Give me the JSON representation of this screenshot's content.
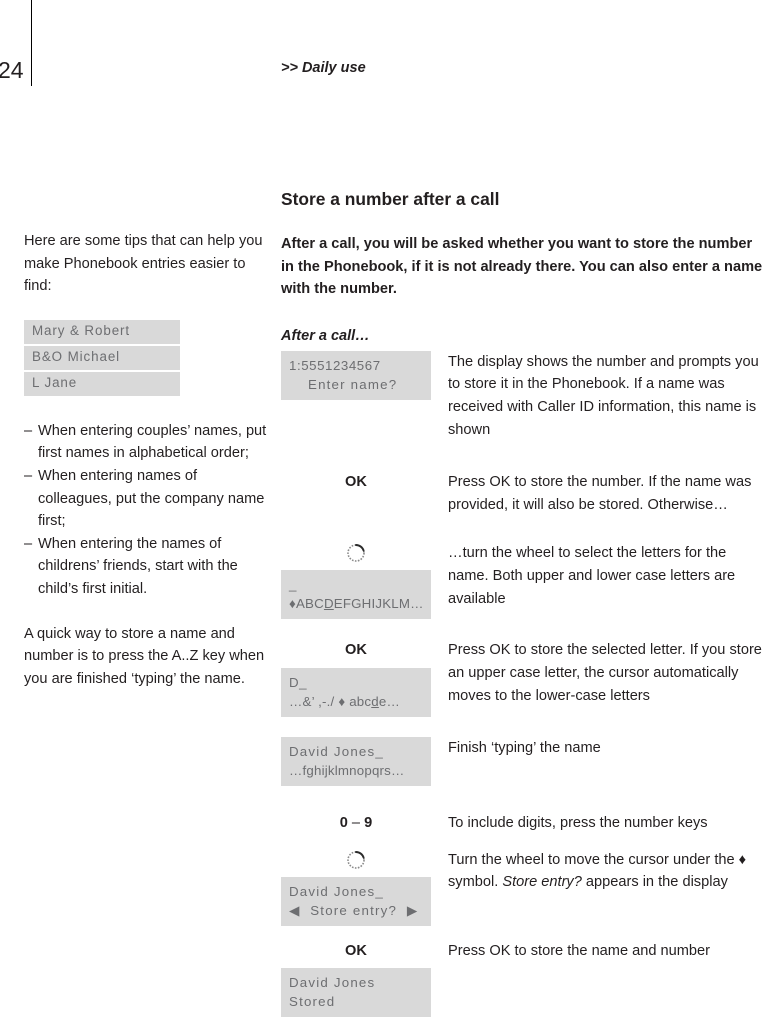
{
  "page": {
    "number": "24",
    "running_head": ">> Daily use"
  },
  "left_column": {
    "intro": "Here are some tips that can help you make Phonebook entries easier to find:",
    "examples": [
      "Mary & Robert",
      "B&O Michael",
      "L Jane"
    ],
    "tips_dash": "–",
    "tips": [
      "When entering couples’ names, put first names in alphabetical order;",
      "When entering names of colleagues, put the company name first;",
      "When entering the names of childrens’ friends, start with the child’s first initial."
    ],
    "closing": "A quick way to store a name and number is to press the A..Z key when you are finished ‘typing’ the name."
  },
  "main": {
    "section_title": "Store a number after a call",
    "intro": "After a call, you will be asked whether you want to store the number in the Phonebook, if it is not already there. You can also enter a name with the number.",
    "subheading": "After a call…",
    "steps": [
      {
        "left_type": "display",
        "display": {
          "line1": "1:5551234567",
          "line2": "Enter name?"
        },
        "description": "The display shows the number and prompts you to store it in the Phonebook. If a name was received with Caller ID information, this name is shown"
      },
      {
        "left_type": "key",
        "key": "OK",
        "description": "Press OK to store the number. If the name was provided, it will also be stored. Otherwise…"
      },
      {
        "left_type": "wheel-display",
        "wheel_icon": "rotate-wheel-icon",
        "display": {
          "line1": "_",
          "line2_pre": "♦ABC",
          "line2_underlined": "D",
          "line2_post": "EFGHIJKLM…"
        },
        "description": "…turn the wheel to select the letters for the name. Both upper and lower case letters are available"
      },
      {
        "left_type": "key-display",
        "key": "OK",
        "display": {
          "line1": "D_",
          "line2_pre": "…&’ ,-./ ♦ abc",
          "line2_underlined": "d",
          "line2_post": "e…"
        },
        "description": "Press OK to store the selected letter. If you store an upper case letter, the cursor automatically moves to the lower-case letters"
      },
      {
        "left_type": "display",
        "display": {
          "line1": "David Jones_",
          "line2": "…fghijklmnopqrs…"
        },
        "description": "Finish ‘typing’ the name"
      },
      {
        "left_type": "key",
        "key_prefix": "0",
        "key_sep": " – ",
        "key_suffix": "9",
        "description": "To include digits, press the number keys"
      },
      {
        "left_type": "wheel-display",
        "wheel_icon": "rotate-wheel-icon",
        "display": {
          "line1": "David Jones_",
          "line2_left_arrow": "◀",
          "line2_text": "Store entry?",
          "line2_right_arrow": "▶"
        },
        "description_pre": "Turn the wheel to move the cursor under the ♦ symbol. ",
        "description_em": "Store entry?",
        "description_post": " appears in the display"
      },
      {
        "left_type": "key-display",
        "key": "OK",
        "display": {
          "line1": "David Jones",
          "line2": "Stored"
        },
        "description": "Press OK to store the name and number"
      }
    ]
  },
  "colors": {
    "display_background": "#d9d9d9",
    "display_text": "#6d6e71",
    "body_text": "#231f20",
    "rule": "#000000"
  }
}
